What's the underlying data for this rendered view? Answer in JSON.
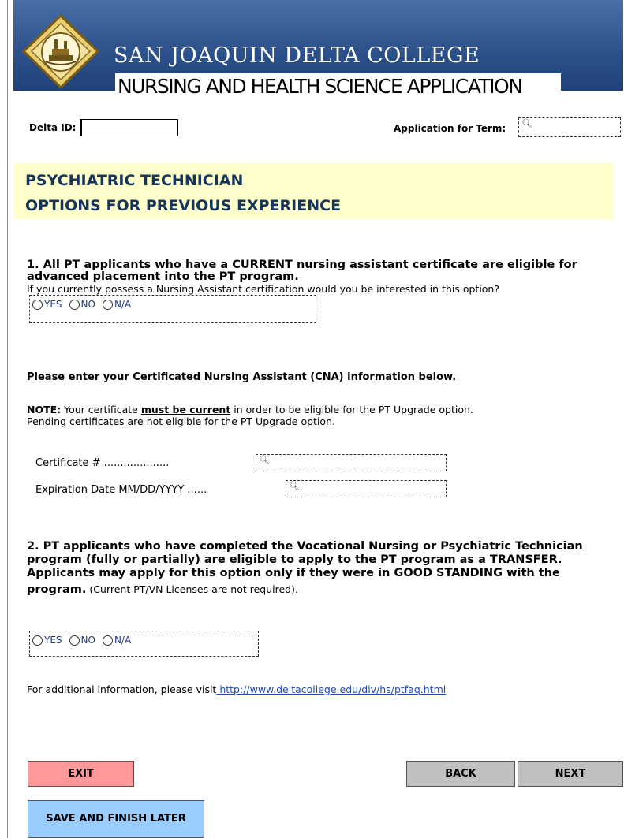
{
  "header": {
    "college_name": "SAN JOAQUIN DELTA COLLEGE",
    "app_title": "NURSING AND HEALTH SCIENCE APPLICATION",
    "logo_icon": "college-seal-logo",
    "banner_color": "#2d528c"
  },
  "top_fields": {
    "delta_id_label": "Delta ID:",
    "delta_id_value": "",
    "term_label": "Application for Term:",
    "term_value": ""
  },
  "heading": {
    "line1": "PSYCHIATRIC TECHNICIAN",
    "line2": "OPTIONS FOR PREVIOUS EXPERIENCE",
    "bg_color": "#ffffcc",
    "text_color": "#17365d"
  },
  "question1": {
    "bold_line1": "1. All PT applicants who have a CURRENT nursing assistant certificate are eligible for",
    "bold_line2": "advanced placement into the PT program.",
    "prompt": "If you currently possess a Nursing Assistant certification would you be interested in this option?",
    "options": [
      "YES",
      "NO",
      "N/A"
    ]
  },
  "cna": {
    "heading": "Please enter your Certificated Nursing Assistant (CNA) information below.",
    "note_label": "NOTE:",
    "note_text_before": " Your certificate ",
    "note_emphasis": "must be current",
    "note_text_after": " in order to be eligible for the PT Upgrade option.",
    "note_line2": "Pending certificates are not eligible for the PT Upgrade option.",
    "certificate_label": "Certificate # ....................",
    "certificate_value": "",
    "expiration_label": "Expiration Date  MM/DD/YYYY ......",
    "expiration_value": ""
  },
  "question2": {
    "bold_line1": "2. PT applicants who have completed the Vocational Nursing or Psychiatric Technician",
    "bold_line2": "program (fully or partially) are eligible to apply to the PT program as a TRANSFER.",
    "bold_line3": "Applicants may apply for this option only if they were in GOOD STANDING with the",
    "bold_line4": "program.",
    "line4_rest": " (Current PT/VN Licenses are not required).",
    "options": [
      "YES",
      "NO",
      "N/A"
    ]
  },
  "info": {
    "text": "For additional information, please visit",
    "link": " http://www.deltacollege.edu/div/hs/ptfaq.html"
  },
  "buttons": {
    "exit": "EXIT",
    "back": "BACK",
    "next": "NEXT",
    "save": "SAVE AND FINISH LATER",
    "exit_color": "#ff9999",
    "nav_color": "#c0c0c0",
    "save_color": "#99ccff"
  }
}
